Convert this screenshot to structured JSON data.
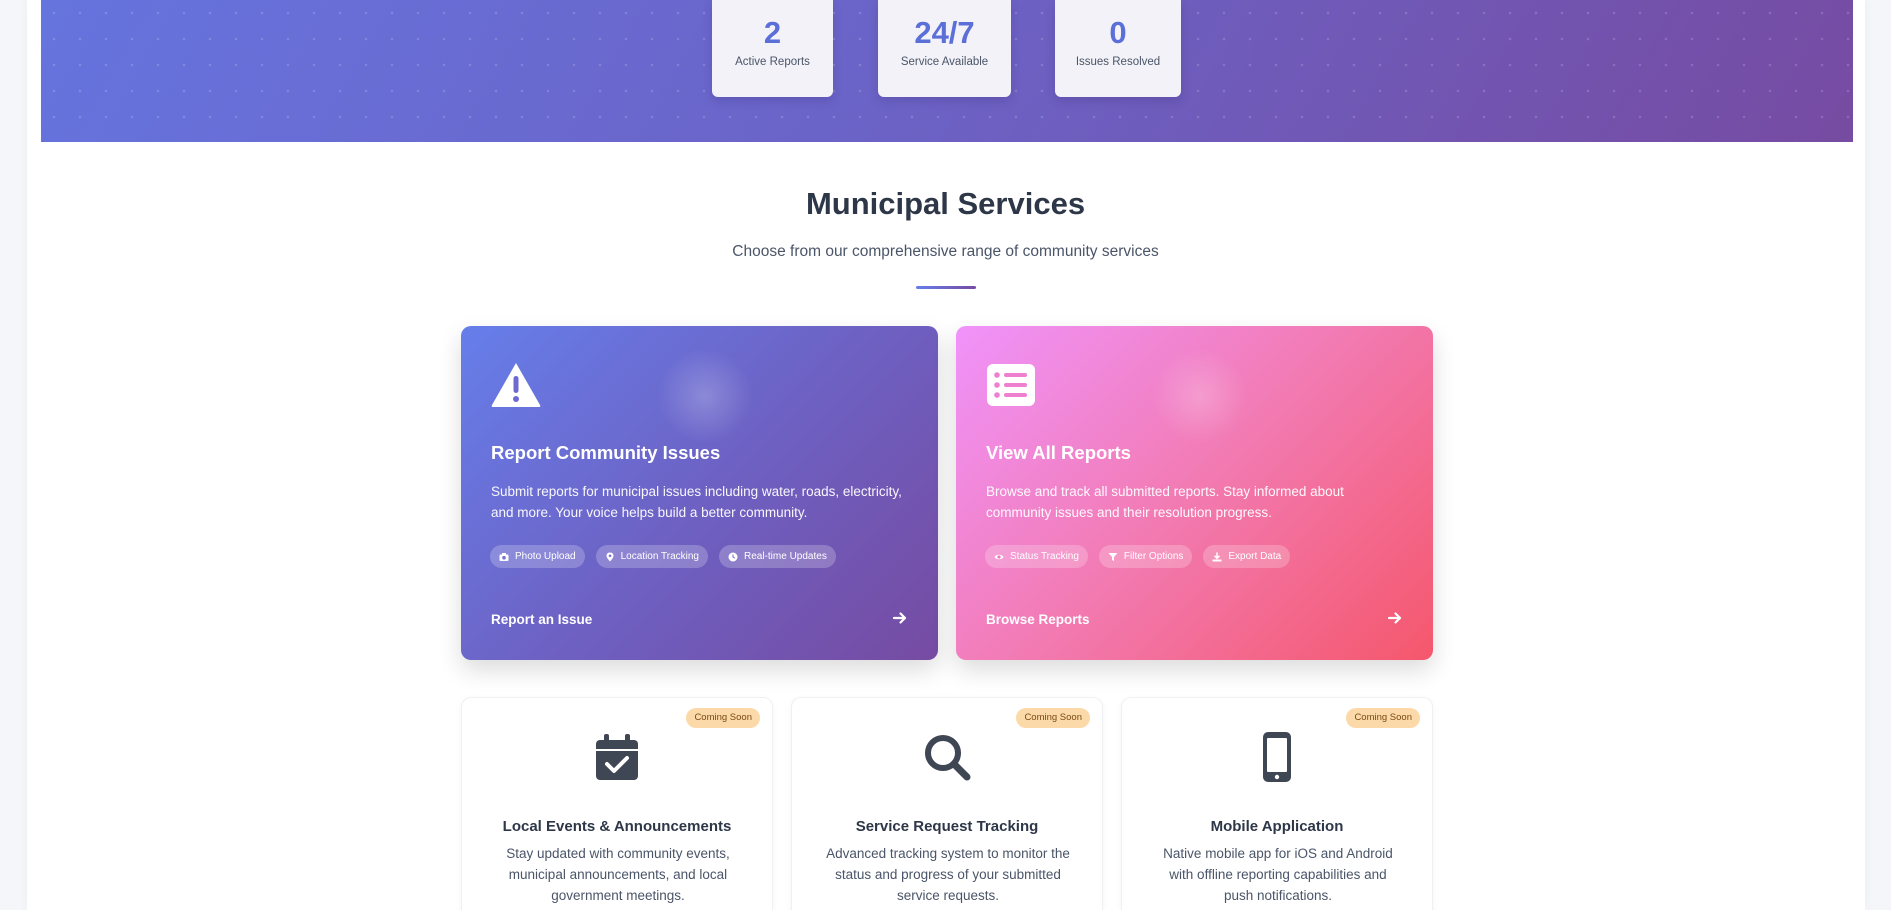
{
  "stats": [
    {
      "value": "2",
      "label": "Active Reports"
    },
    {
      "value": "24/7",
      "label": "Service Available"
    },
    {
      "value": "0",
      "label": "Issues Resolved"
    }
  ],
  "section": {
    "title": "Municipal Services",
    "subtitle": "Choose from our comprehensive range of community services"
  },
  "services": [
    {
      "icon": "warning-triangle-icon",
      "title": "Report Community Issues",
      "description": "Submit reports for municipal issues including water, roads, electricity, and more. Your voice helps build a better community.",
      "features": [
        {
          "icon": "camera-icon",
          "label": "Photo Upload"
        },
        {
          "icon": "map-pin-icon",
          "label": "Location Tracking"
        },
        {
          "icon": "clock-icon",
          "label": "Real-time Updates"
        }
      ],
      "action": "Report an Issue",
      "gradient": [
        "#667eea",
        "#764ba2"
      ]
    },
    {
      "icon": "list-icon",
      "title": "View All Reports",
      "description": "Browse and track all submitted reports. Stay informed about community issues and their resolution progress.",
      "features": [
        {
          "icon": "eye-icon",
          "label": "Status Tracking"
        },
        {
          "icon": "filter-icon",
          "label": "Filter Options"
        },
        {
          "icon": "download-icon",
          "label": "Export Data"
        }
      ],
      "action": "Browse Reports",
      "gradient": [
        "#f093fb",
        "#f5576c"
      ]
    }
  ],
  "coming_soon": [
    {
      "badge": "Coming Soon",
      "icon": "calendar-check-icon",
      "title": "Local Events & Announcements",
      "description": "Stay updated with community events, municipal announcements, and local government meetings."
    },
    {
      "badge": "Coming Soon",
      "icon": "search-icon",
      "title": "Service Request Tracking",
      "description": "Advanced tracking system to monitor the status and progress of your submitted service requests."
    },
    {
      "badge": "Coming Soon",
      "icon": "mobile-phone-icon",
      "title": "Mobile Application",
      "description": "Native mobile app for iOS and Android with offline reporting capabilities and push notifications."
    }
  ],
  "colors": {
    "accent": "#5a6fd8",
    "badge_bg": "#fcd9a8",
    "icon_dark": "#3f4654"
  }
}
